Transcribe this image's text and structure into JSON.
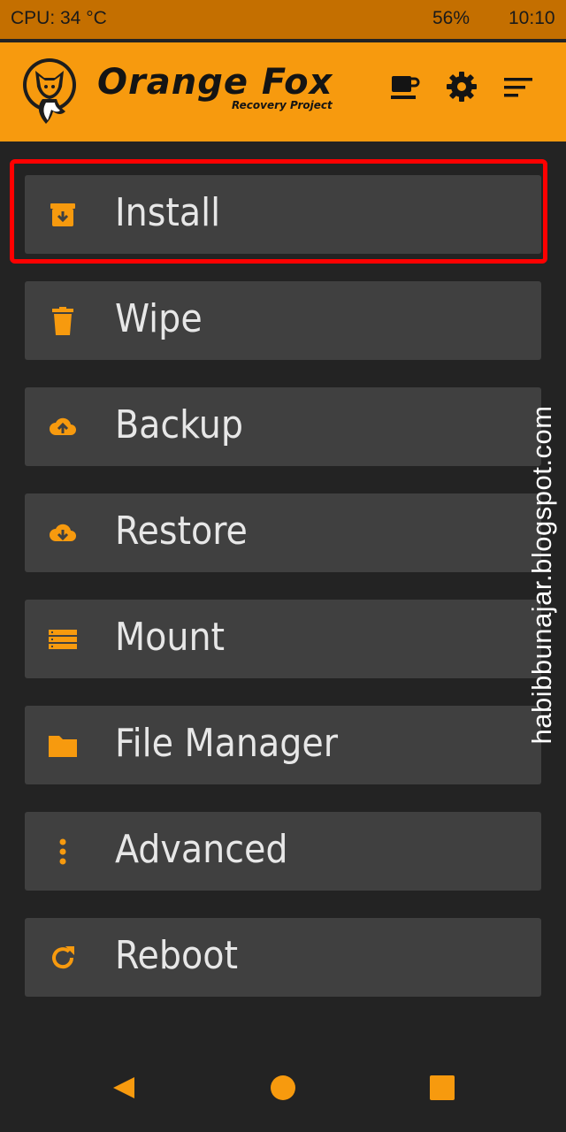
{
  "status_bar": {
    "cpu": "CPU: 34 °C",
    "battery": "56%",
    "time": "10:10"
  },
  "header": {
    "brand": "Orange Fox",
    "subtitle": "Recovery Project",
    "logo_icon": "fox-logo-icon",
    "actions": [
      {
        "name": "donate-icon"
      },
      {
        "name": "gear-icon"
      },
      {
        "name": "menu-sort-icon"
      }
    ]
  },
  "menu": {
    "highlighted": "Install",
    "items": [
      {
        "label": "Install",
        "icon": "install-archive-icon"
      },
      {
        "label": "Wipe",
        "icon": "trash-icon"
      },
      {
        "label": "Backup",
        "icon": "cloud-upload-icon"
      },
      {
        "label": "Restore",
        "icon": "cloud-download-icon"
      },
      {
        "label": "Mount",
        "icon": "storage-list-icon"
      },
      {
        "label": "File Manager",
        "icon": "folder-icon"
      },
      {
        "label": "Advanced",
        "icon": "more-vertical-icon"
      },
      {
        "label": "Reboot",
        "icon": "refresh-icon"
      }
    ]
  },
  "watermark": "habibbunajar.blogspot.com",
  "colors": {
    "accent": "#f79a0e",
    "status_bar": "#c46f00",
    "background": "#232323",
    "button": "#404040",
    "highlight": "#ff0000"
  },
  "navigation": {
    "back": "back-triangle-icon",
    "home": "home-circle-icon",
    "recents": "recents-square-icon"
  }
}
